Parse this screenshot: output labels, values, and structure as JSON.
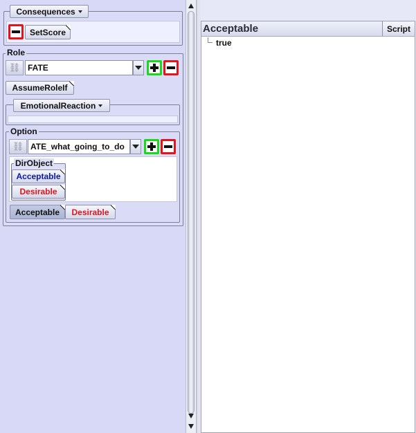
{
  "consequences": {
    "dropdown_label": "Consequences",
    "setscore_label": "SetScore"
  },
  "role": {
    "legend": "Role",
    "selected_value": "FATE",
    "assume_button": "AssumeRoleIf",
    "emotional_dropdown": "EmotionalReaction"
  },
  "option": {
    "legend": "Option",
    "selected_value": "ATE_what_going_to_do",
    "dirobject": {
      "label": "DirObject",
      "items": [
        "Acceptable",
        "Desirable"
      ]
    },
    "tabs": [
      "Acceptable",
      "Desirable"
    ]
  },
  "editor": {
    "title": "Acceptable",
    "script_button": "Script",
    "tree_root": "true"
  },
  "colors": {
    "accent_blue": "#0b1aa8",
    "accent_red": "#e0141b",
    "add_green": "#18d91a",
    "remove_red": "#e5141a"
  },
  "icons": {
    "link": "link-icon",
    "add": "plus-icon",
    "remove": "minus-icon"
  }
}
